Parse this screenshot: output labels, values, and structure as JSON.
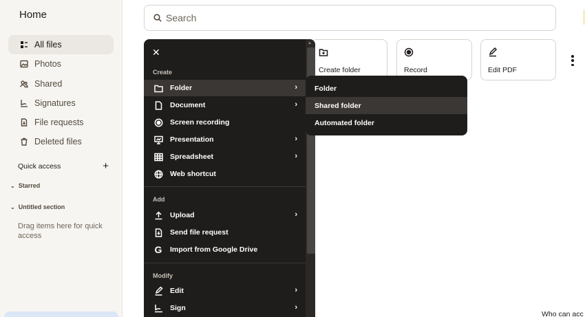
{
  "sidebar": {
    "home_title": "Home",
    "items": [
      {
        "label": "All files",
        "icon": "all-files-icon",
        "active": true
      },
      {
        "label": "Photos",
        "icon": "photos-icon"
      },
      {
        "label": "Shared",
        "icon": "shared-icon"
      },
      {
        "label": "Signatures",
        "icon": "signatures-icon"
      },
      {
        "label": "File requests",
        "icon": "file-requests-icon"
      },
      {
        "label": "Deleted files",
        "icon": "deleted-files-icon"
      }
    ],
    "quick_access": "Quick access",
    "quick_access_add": "+",
    "starred": "Starred",
    "untitled_section": "Untitled section",
    "drag_hint": "Drag items here for quick access"
  },
  "search": {
    "placeholder": "Search"
  },
  "tiles": [
    {
      "label": "Create folder",
      "icon": "create-folder-icon"
    },
    {
      "label": "Record",
      "icon": "record-icon"
    },
    {
      "label": "Edit PDF",
      "icon": "edit-pdf-icon"
    }
  ],
  "menu": {
    "close": "✕",
    "sections": {
      "create": "Create",
      "add": "Add",
      "modify": "Modify"
    },
    "create_items": [
      {
        "label": "Folder",
        "icon": "folder-icon",
        "has_submenu": true,
        "highlighted": true
      },
      {
        "label": "Document",
        "icon": "document-icon",
        "has_submenu": true
      },
      {
        "label": "Screen recording",
        "icon": "screen-recording-icon",
        "has_submenu": false
      },
      {
        "label": "Presentation",
        "icon": "presentation-icon",
        "has_submenu": true
      },
      {
        "label": "Spreadsheet",
        "icon": "spreadsheet-icon",
        "has_submenu": true
      },
      {
        "label": "Web shortcut",
        "icon": "globe-icon",
        "has_submenu": false
      }
    ],
    "add_items": [
      {
        "label": "Upload",
        "icon": "upload-icon",
        "has_submenu": true
      },
      {
        "label": "Send file request",
        "icon": "file-request-icon",
        "has_submenu": false
      },
      {
        "label": "Import from Google Drive",
        "icon": "google-icon",
        "has_submenu": false
      }
    ],
    "modify_items": [
      {
        "label": "Edit",
        "icon": "edit-icon",
        "has_submenu": true
      },
      {
        "label": "Sign",
        "icon": "sign-icon",
        "has_submenu": true
      }
    ],
    "arrow": "›"
  },
  "submenu": {
    "items": [
      {
        "label": "Folder"
      },
      {
        "label": "Shared folder",
        "highlighted": true
      },
      {
        "label": "Automated folder"
      }
    ]
  },
  "footer_text": "Who can acc"
}
